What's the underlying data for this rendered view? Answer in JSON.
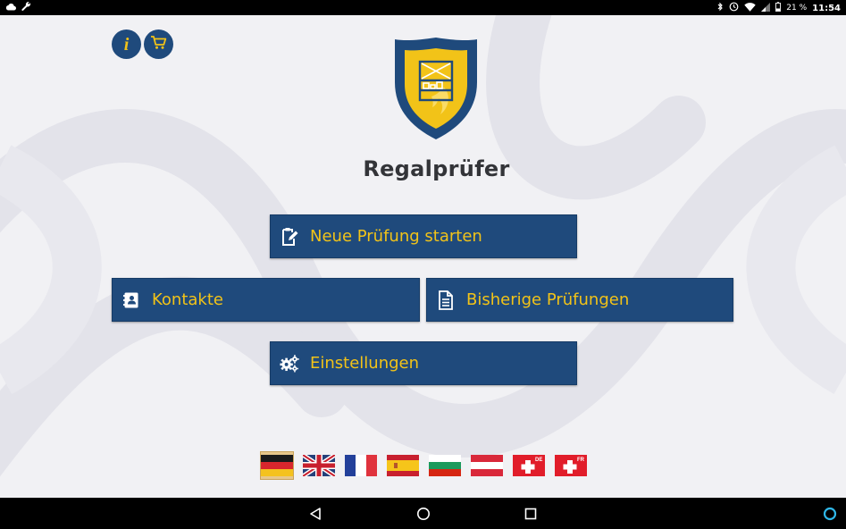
{
  "status_bar": {
    "battery_percent": "21 %",
    "time": "11:54",
    "left_icons": [
      "cloud-icon",
      "wrench-icon"
    ],
    "right_icons": [
      "bluetooth-icon",
      "sync-icon",
      "wifi-icon",
      "signal-icon",
      "battery-icon"
    ]
  },
  "header": {
    "app_title": "Regalprüfer",
    "info_icon": "info-icon",
    "cart_icon": "cart-icon"
  },
  "menu": {
    "new_inspection": "Neue Prüfung starten",
    "contacts": "Kontakte",
    "previous_inspections": "Bisherige Prüfungen",
    "settings": "Einstellungen"
  },
  "languages": {
    "selected": "de",
    "flags": [
      {
        "code": "de",
        "icon": "flag-germany-icon"
      },
      {
        "code": "en",
        "icon": "flag-uk-icon"
      },
      {
        "code": "fr",
        "icon": "flag-france-icon"
      },
      {
        "code": "es",
        "icon": "flag-spain-icon"
      },
      {
        "code": "bg",
        "icon": "flag-bulgaria-icon"
      },
      {
        "code": "at",
        "icon": "flag-austria-icon"
      },
      {
        "code": "ch-de",
        "icon": "flag-switzerland-de-icon",
        "badge": "DE"
      },
      {
        "code": "ch-fr",
        "icon": "flag-switzerland-fr-icon",
        "badge": "FR"
      }
    ]
  },
  "colors": {
    "primary": "#1f4a7c",
    "accent": "#f2c318",
    "background": "#f1f1f4",
    "title": "#333438"
  },
  "navbar": {
    "icons": [
      "back-icon",
      "home-icon",
      "recents-icon",
      "assistant-icon"
    ]
  }
}
